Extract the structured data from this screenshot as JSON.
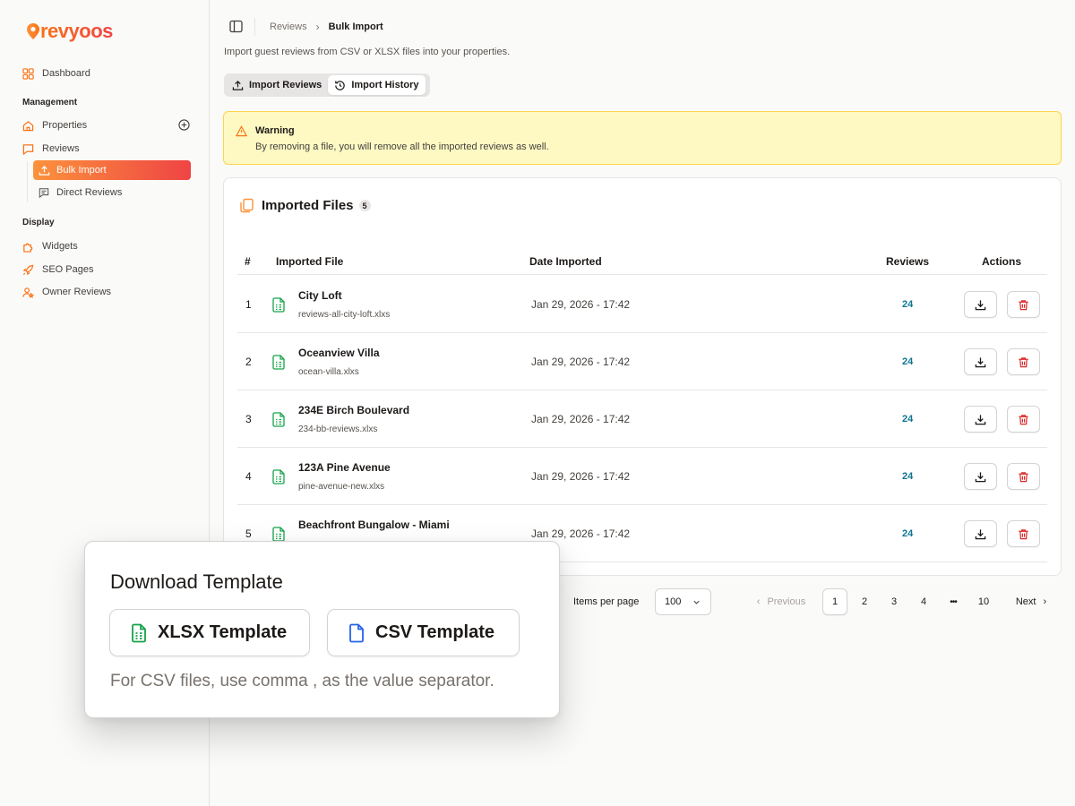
{
  "brand": {
    "name": "revyoos",
    "color": "#f97316",
    "accent2": "#ef4444"
  },
  "sidebar": {
    "dashboard": "Dashboard",
    "section_management": "Management",
    "properties": "Properties",
    "reviews": "Reviews",
    "bulk_import": "Bulk Import",
    "direct_reviews": "Direct Reviews",
    "section_display": "Display",
    "widgets": "Widgets",
    "seo_pages": "SEO Pages",
    "owner_reviews": "Owner Reviews"
  },
  "breadcrumb": {
    "parent": "Reviews",
    "current": "Bulk Import"
  },
  "subtitle": "Import guest reviews from CSV or XLSX files into your properties.",
  "tabs": [
    {
      "label": "Import Reviews",
      "icon": "upload-icon"
    },
    {
      "label": "Import History",
      "icon": "history-icon",
      "selected": true
    }
  ],
  "warning": {
    "title": "Warning",
    "message": "By removing a file, you will remove all the imported reviews as well."
  },
  "files_card": {
    "title": "Imported Files",
    "count": "5",
    "columns": {
      "index": "#",
      "file": "Imported File",
      "date": "Date Imported",
      "reviews": "Reviews",
      "actions": "Actions"
    },
    "rows": [
      {
        "index": "1",
        "name": "City Loft",
        "file": "reviews-all-city-loft.xlxs",
        "date": "Jan 29, 2026 - 17:42",
        "reviews": "24"
      },
      {
        "index": "2",
        "name": "Oceanview Villa",
        "file": "ocean-villa.xlxs",
        "date": "Jan 29, 2026 - 17:42",
        "reviews": "24"
      },
      {
        "index": "3",
        "name": "234E Birch Boulevard",
        "file": "234-bb-reviews.xlxs",
        "date": "Jan 29, 2026 - 17:42",
        "reviews": "24"
      },
      {
        "index": "4",
        "name": "123A Pine Avenue",
        "file": "pine-avenue-new.xlxs",
        "date": "Jan 29, 2026 - 17:42",
        "reviews": "24"
      },
      {
        "index": "5",
        "name": "Beachfront Bungalow - Miami",
        "file": "",
        "date": "Jan 29, 2026 - 17:42",
        "reviews": "24"
      }
    ]
  },
  "pagination": {
    "items_per_page_label": "Items per page",
    "items_per_page_value": "100",
    "previous": "Previous",
    "pages": [
      "1",
      "2",
      "3",
      "4",
      "•••",
      "10"
    ],
    "current_page": "1",
    "next": "Next"
  },
  "popover": {
    "title": "Download Template",
    "xlsx_label": "XLSX Template",
    "csv_label": "CSV Template",
    "note": "For CSV files, use comma , as the value separator."
  }
}
